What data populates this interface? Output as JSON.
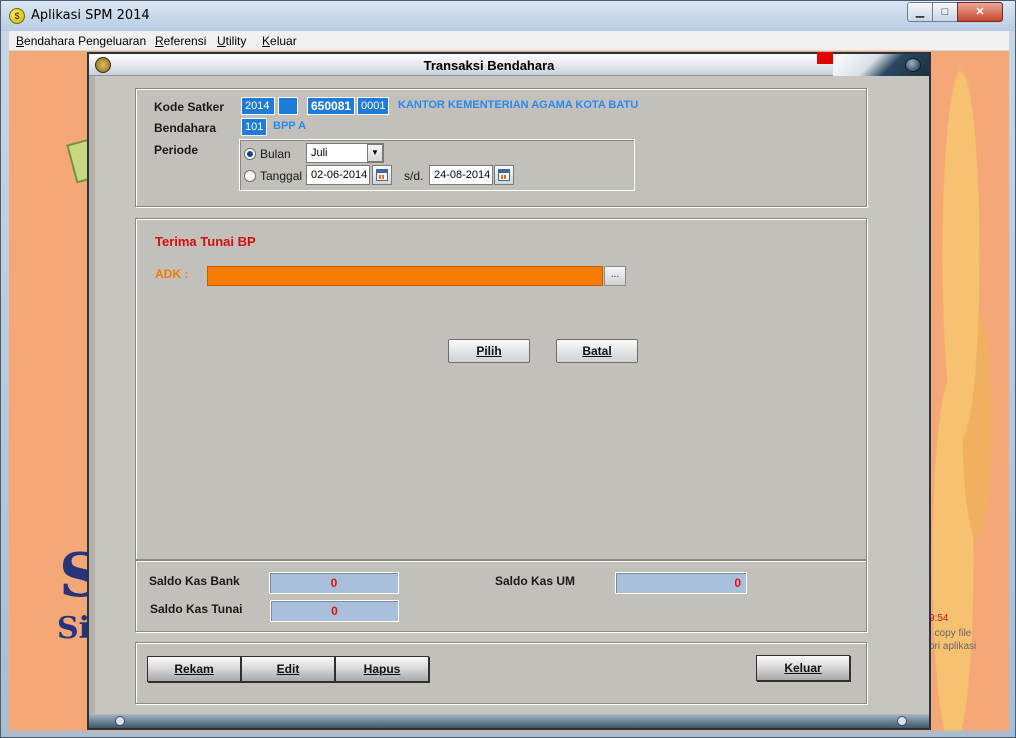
{
  "window": {
    "title": "Aplikasi SPM 2014",
    "icon": "app-logo-icon",
    "controls": {
      "minimize": "▁",
      "maximize": "□",
      "close": "✕"
    }
  },
  "menu": {
    "items": [
      "Bendahara Pengeluaran",
      "Referensi",
      "Utility",
      "Keluar"
    ]
  },
  "background": {
    "notes": [
      "9:54",
      ", copy file",
      "ori aplikasi"
    ]
  },
  "dialog": {
    "title": "Transaksi Bendahara",
    "header": {
      "kode_satker_label": "Kode Satker",
      "kode_satker": {
        "year": "2014",
        "blank": "",
        "code": "650081",
        "sub": "0001",
        "name": "KANTOR KEMENTERIAN AGAMA KOTA BATU"
      },
      "bendahara_label": "Bendahara",
      "bendahara": {
        "code": "101",
        "name": "BPP A"
      },
      "periode_label": "Periode",
      "periode": {
        "bulan_label": "Bulan",
        "bulan_value": "Juli",
        "tanggal_label": "Tanggal",
        "tanggal_from": "02-06-2014",
        "sd_label": "s/d.",
        "tanggal_to": "24-08-2014",
        "selected": "bulan"
      }
    },
    "main": {
      "section_title": "Terima Tunai BP",
      "adk_label": "ADK :",
      "adk_value": "",
      "browse_label": "...",
      "pilih_label": "Pilih",
      "batal_label": "Batal"
    },
    "saldo": {
      "kas_bank_label": "Saldo Kas Bank",
      "kas_bank_value": "0",
      "kas_um_label": "Saldo Kas UM",
      "kas_um_value": "0",
      "kas_tunai_label": "Saldo Kas Tunai",
      "kas_tunai_value": "0"
    },
    "footer": {
      "rekam_label": "Rekam",
      "edit_label": "Edit",
      "hapus_label": "Hapus",
      "keluar_label": "Keluar"
    }
  },
  "colors": {
    "accent_blue": "#1f7ad8",
    "title_red": "#d01010",
    "adk_orange": "#f57c00",
    "saldo_box": "#a9c0dc"
  }
}
